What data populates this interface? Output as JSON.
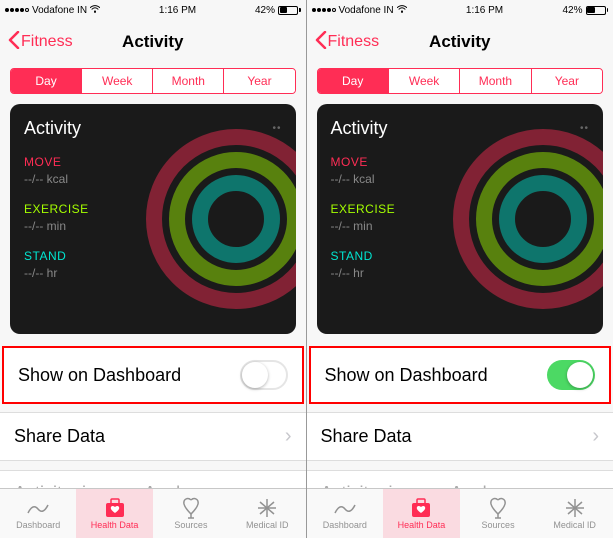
{
  "status": {
    "carrier": "Vodafone IN",
    "time": "1:16 PM",
    "battery_pct": "42%"
  },
  "nav": {
    "back": "Fitness",
    "title": "Activity"
  },
  "segments": {
    "day": "Day",
    "week": "Week",
    "month": "Month",
    "year": "Year"
  },
  "card": {
    "title": "Activity",
    "move_label": "MOVE",
    "move_value": "--/-- kcal",
    "exercise_label": "EXERCISE",
    "exercise_value": "--/-- min",
    "stand_label": "STAND",
    "stand_value": "--/-- hr"
  },
  "rows": {
    "show_dashboard": "Show on Dashboard",
    "share_data": "Share Data",
    "activity_rings": "Activity rings on Apple"
  },
  "tabs": {
    "dashboard": "Dashboard",
    "health_data": "Health Data",
    "sources": "Sources",
    "medical_id": "Medical ID"
  },
  "toggles": {
    "left_state": "off",
    "right_state": "on"
  }
}
